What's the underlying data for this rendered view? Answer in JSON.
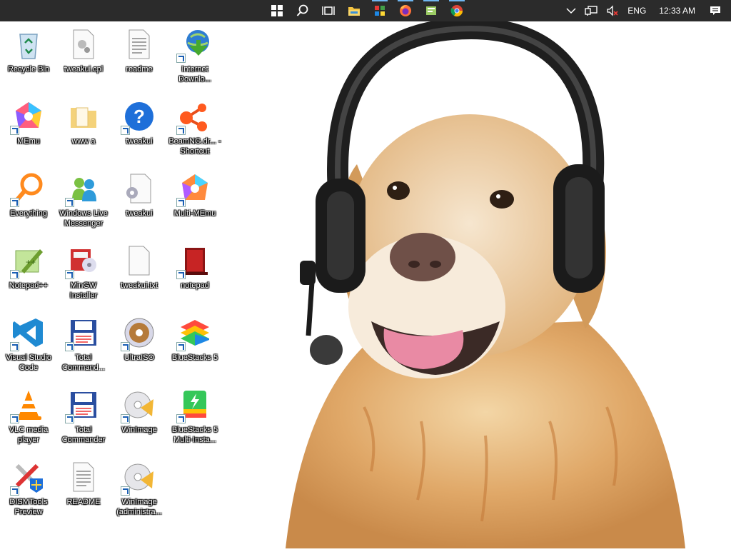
{
  "taskbar": {
    "apps": [
      {
        "name": "start-icon"
      },
      {
        "name": "search-icon"
      },
      {
        "name": "task-view-icon"
      },
      {
        "name": "file-explorer-icon"
      },
      {
        "name": "app-icon-colorful"
      },
      {
        "name": "firefox-icon"
      },
      {
        "name": "notepad-plus-icon"
      },
      {
        "name": "chrome-icon"
      }
    ],
    "tray": {
      "language": "ENG",
      "time": "12:33 AM"
    }
  },
  "desktop": {
    "icons": [
      {
        "label": "Recycle Bin",
        "icon": "recycle-bin-icon"
      },
      {
        "label": "tweakui.cpl",
        "icon": "cpl-file-icon"
      },
      {
        "label": "readme",
        "icon": "text-file-icon"
      },
      {
        "label": "Internet Downlo...",
        "icon": "internet-download-manager-icon"
      },
      {
        "label": "MEmu",
        "icon": "memu-icon"
      },
      {
        "label": "www a",
        "icon": "folder-icon"
      },
      {
        "label": "tweakui",
        "icon": "help-icon"
      },
      {
        "label": "BeamNG.dr... - Shortcut",
        "icon": "beamng-icon"
      },
      {
        "label": "Everything",
        "icon": "everything-search-icon"
      },
      {
        "label": "Windows Live Messenger",
        "icon": "messenger-icon"
      },
      {
        "label": "tweakui",
        "icon": "settings-file-icon"
      },
      {
        "label": "Multi-MEmu",
        "icon": "multi-memu-icon"
      },
      {
        "label": "Notepad++",
        "icon": "notepad-plus-plus-icon"
      },
      {
        "label": "MinGW Installer",
        "icon": "mingw-installer-icon"
      },
      {
        "label": "tweakui.txt",
        "icon": "blank-file-icon"
      },
      {
        "label": "notepad",
        "icon": "notepad-icon"
      },
      {
        "label": "Visual Studio Code",
        "icon": "vscode-icon"
      },
      {
        "label": "Total Command...",
        "icon": "total-commander-icon"
      },
      {
        "label": "UltraISO",
        "icon": "ultraiso-icon"
      },
      {
        "label": "BlueStacks 5",
        "icon": "bluestacks-icon"
      },
      {
        "label": "VLC media player",
        "icon": "vlc-icon"
      },
      {
        "label": "Total Commander",
        "icon": "total-commander-icon"
      },
      {
        "label": "WinImage",
        "icon": "winimage-icon"
      },
      {
        "label": "BlueStacks 5 Multi-Insta...",
        "icon": "bluestacks-multi-icon"
      },
      {
        "label": "DISMTools Preview",
        "icon": "dismtools-icon"
      },
      {
        "label": "README",
        "icon": "text-file-icon"
      },
      {
        "label": "WinImage (administra...",
        "icon": "winimage-icon"
      }
    ]
  }
}
